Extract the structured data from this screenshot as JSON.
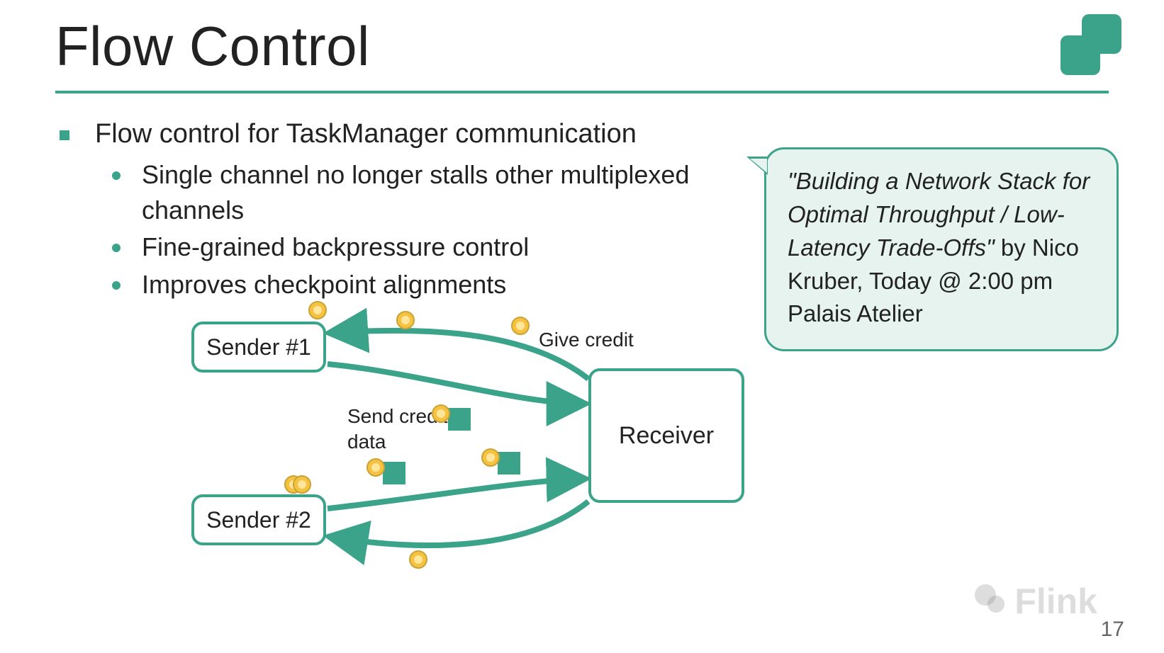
{
  "title": "Flow Control",
  "bullets": {
    "main": "Flow control for TaskManager communication",
    "sub": [
      "Single channel no longer stalls other multiplexed channels",
      "Fine-grained backpressure control",
      "Improves checkpoint alignments"
    ]
  },
  "callout": {
    "quote": "\"Building a Network Stack for Optimal Throughput / Low-Latency Trade-Offs\"",
    "byline": "by Nico Kruber, Today @ 2:00 pm Palais Atelier"
  },
  "diagram": {
    "nodes": {
      "sender1": "Sender #1",
      "sender2": "Sender #2",
      "receiver": "Receiver"
    },
    "labels": {
      "give_credit": "Give credit",
      "send_credited": "Send credited data"
    },
    "edges": [
      {
        "from": "receiver",
        "to": "sender1",
        "kind": "credit"
      },
      {
        "from": "sender1",
        "to": "receiver",
        "kind": "data"
      },
      {
        "from": "sender2",
        "to": "receiver",
        "kind": "data"
      },
      {
        "from": "receiver",
        "to": "sender2",
        "kind": "credit"
      }
    ]
  },
  "watermark": "Flink",
  "page_number": "17",
  "colors": {
    "accent": "#3aa38a",
    "callout_bg": "#e6f3ef",
    "coin": "#f5c242"
  }
}
